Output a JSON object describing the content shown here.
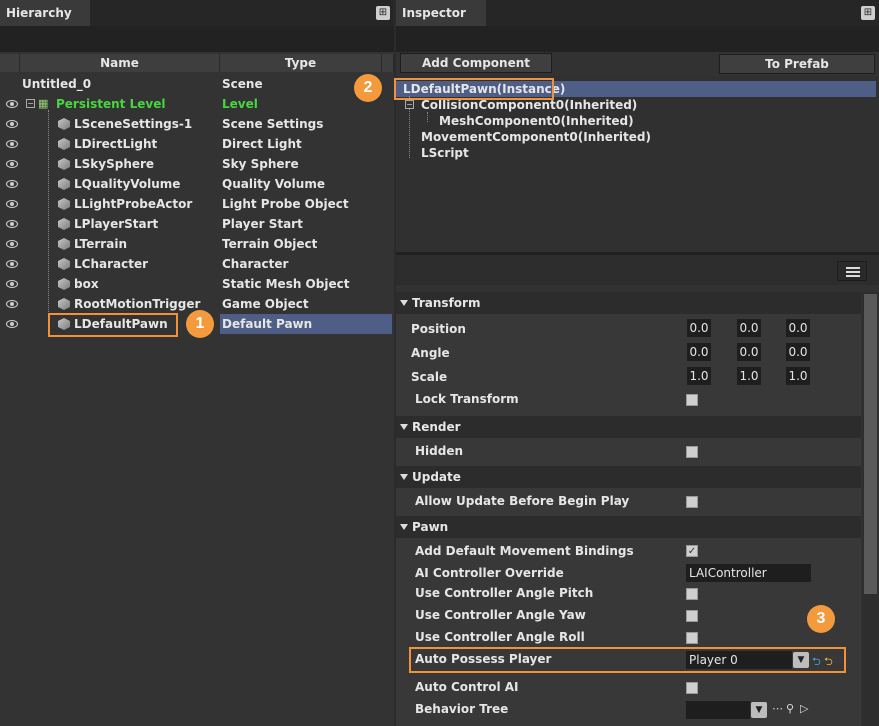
{
  "hierarchy": {
    "title": "Hierarchy",
    "columns": {
      "name": "Name",
      "type": "Type"
    },
    "rows": [
      {
        "name": "Untitled_0",
        "type": "Scene"
      },
      {
        "name": "Persistent Level",
        "type": "Level"
      },
      {
        "name": "LSceneSettings-1",
        "type": "Scene Settings"
      },
      {
        "name": "LDirectLight",
        "type": "Direct Light"
      },
      {
        "name": "LSkySphere",
        "type": "Sky Sphere"
      },
      {
        "name": "LQualityVolume",
        "type": "Quality Volume"
      },
      {
        "name": "LLightProbeActor",
        "type": "Light Probe Object"
      },
      {
        "name": "LPlayerStart",
        "type": "Player Start"
      },
      {
        "name": "LTerrain",
        "type": "Terrain Object"
      },
      {
        "name": "LCharacter",
        "type": "Character"
      },
      {
        "name": "box",
        "type": "Static Mesh Object"
      },
      {
        "name": "RootMotionTrigger",
        "type": "Game Object"
      },
      {
        "name": "LDefaultPawn",
        "type": "Default Pawn"
      }
    ]
  },
  "inspector": {
    "title": "Inspector",
    "add_component": "Add Component",
    "to_prefab": "To Prefab",
    "components": [
      "LDefaultPawn(Instance)",
      "CollisionComponent0(Inherited)",
      "MeshComponent0(Inherited)",
      "MovementComponent0(Inherited)",
      "LScript"
    ],
    "transform": {
      "title": "Transform",
      "position_label": "Position",
      "position": [
        "0.0",
        "0.0",
        "0.0"
      ],
      "angle_label": "Angle",
      "angle": [
        "0.0",
        "0.0",
        "0.0"
      ],
      "scale_label": "Scale",
      "scale": [
        "1.0",
        "1.0",
        "1.0"
      ],
      "lock_label": "Lock Transform"
    },
    "render": {
      "title": "Render",
      "hidden_label": "Hidden"
    },
    "update": {
      "title": "Update",
      "allow_label": "Allow Update Before Begin Play"
    },
    "pawn": {
      "title": "Pawn",
      "add_default_label": "Add Default Movement Bindings",
      "ai_override_label": "AI Controller Override",
      "ai_override_value": "LAIController",
      "pitch_label": "Use Controller Angle Pitch",
      "yaw_label": "Use Controller Angle Yaw",
      "roll_label": "Use Controller Angle Roll",
      "auto_possess_label": "Auto Possess Player",
      "auto_possess_value": "Player 0",
      "auto_control_label": "Auto Control AI",
      "behavior_tree_label": "Behavior Tree"
    }
  },
  "badges": {
    "one": "1",
    "two": "2",
    "three": "3"
  },
  "colors": {
    "accent_orange": "#f0923a",
    "selection": "#4e5e86",
    "level_green": "#48d63e"
  }
}
